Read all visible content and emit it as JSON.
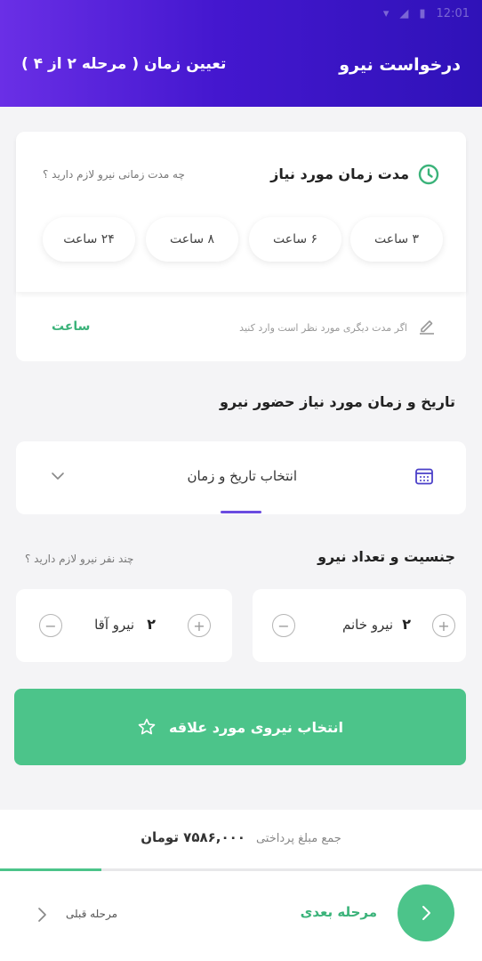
{
  "status_bar": {
    "time": "12:01"
  },
  "header": {
    "title": "درخواست نیرو",
    "step": "تعیین زمان ( مرحله ۲ از ۴ )"
  },
  "duration": {
    "title": "مدت زمان مورد نیاز",
    "hint": "چه مدت زمانی نیرو لازم دارید ؟",
    "options": [
      "۳ ساعت",
      "۶ ساعت",
      "۸ ساعت",
      "۲۴ ساعت"
    ],
    "custom_placeholder": "اگر مدت دیگری مورد نظر است وارد کنید",
    "custom_unit": "ساعت"
  },
  "datetime": {
    "section_title": "تاریخ و زمان مورد نیاز حضور نیرو",
    "select_label": "انتخاب تاریخ و زمان"
  },
  "staff": {
    "section_title": "جنسیت و تعداد نیرو",
    "hint": "چند نفر نیرو لازم دارید ؟",
    "female": {
      "label": "نیرو خانم",
      "count": "۲"
    },
    "male": {
      "label": "نیرو آقا",
      "count": "۲"
    }
  },
  "favorite": {
    "label": "انتخاب نیروی مورد علاقه"
  },
  "footer": {
    "total_label": "جمع مبلغ پرداختی",
    "total_value": "۷۵۸۶,۰۰۰ تومان",
    "progress": 0.21,
    "next_label": "مرحله بعدی",
    "prev_label": "مرحله قبلی"
  },
  "colors": {
    "header_gradient": [
      "#6a2fe6",
      "#2f12b8"
    ],
    "accent_green": "#4cc48a",
    "accent_purple": "#6a4be0"
  }
}
